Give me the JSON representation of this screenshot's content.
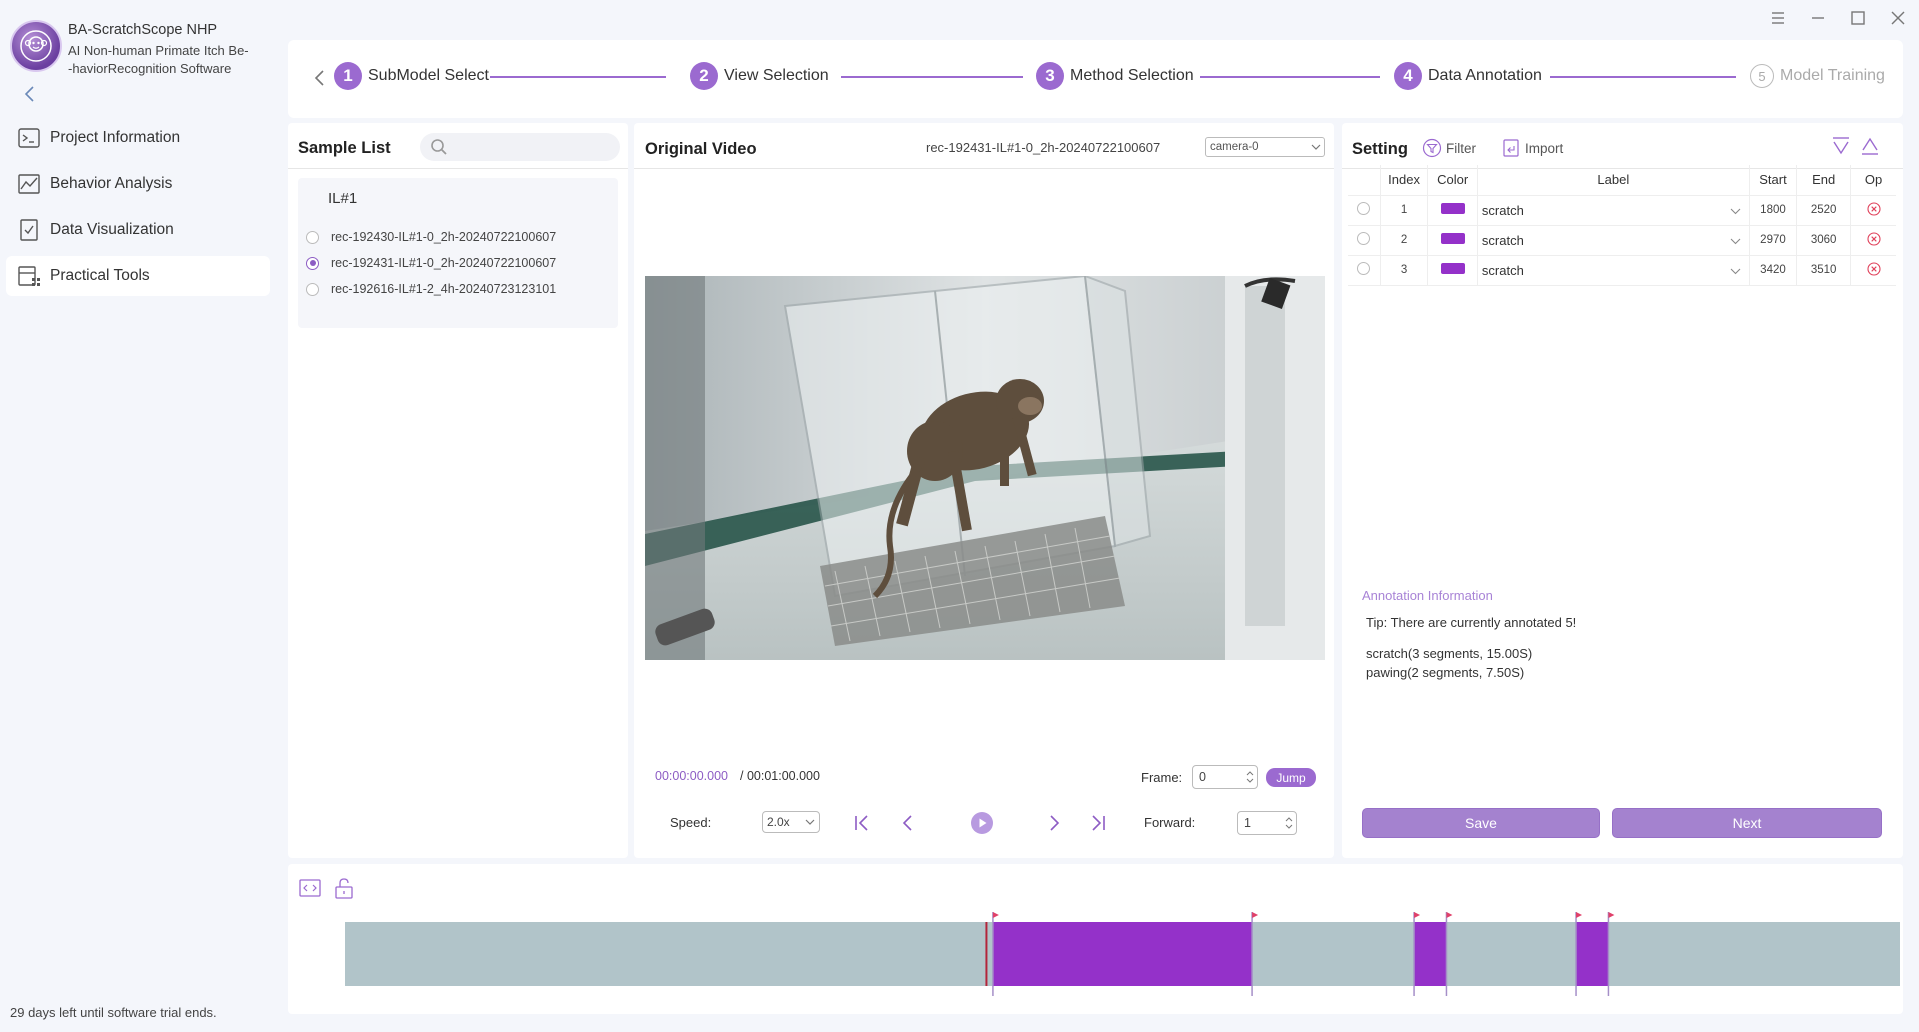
{
  "app": {
    "title": "BA-ScratchScope NHP",
    "subtitle_line1": "AI Non-human Primate Itch Be-",
    "subtitle_line2": "-haviorRecognition Software",
    "trial_notice": "29 days left until software trial ends."
  },
  "nav": {
    "items": [
      {
        "label": "Project Information",
        "icon": "terminal-icon"
      },
      {
        "label": "Behavior Analysis",
        "icon": "chart-icon"
      },
      {
        "label": "Data Visualization",
        "icon": "check-doc-icon"
      },
      {
        "label": "Practical Tools",
        "icon": "tools-icon"
      }
    ],
    "active": "Practical Tools"
  },
  "steps": [
    {
      "num": "1",
      "label": "SubModel Select"
    },
    {
      "num": "2",
      "label": "View Selection"
    },
    {
      "num": "3",
      "label": "Method Selection"
    },
    {
      "num": "4",
      "label": "Data Annotation"
    },
    {
      "num": "5",
      "label": "Model Training"
    }
  ],
  "sample_list": {
    "title": "Sample List",
    "search_placeholder": "",
    "group": "IL#1",
    "items": [
      "rec-192430-IL#1-0_2h-20240722100607",
      "rec-192431-IL#1-0_2h-20240722100607",
      "rec-192616-IL#1-2_4h-20240723123101"
    ],
    "selected_index": 1
  },
  "video": {
    "title": "Original Video",
    "file": "rec-192431-IL#1-0_2h-20240722100607",
    "camera": "camera-0",
    "time_current": "00:00:00.000",
    "time_total": "/ 00:01:00.000",
    "frame_label": "Frame:",
    "frame_value": "0",
    "jump_label": "Jump",
    "speed_label": "Speed:",
    "speed_value": "2.0x",
    "forward_label": "Forward:",
    "forward_value": "1"
  },
  "setting": {
    "title": "Setting",
    "filter_label": "Filter",
    "import_label": "Import",
    "columns": [
      "Index",
      "Color",
      "Label",
      "Start",
      "End",
      "Op"
    ],
    "rows": [
      {
        "index": "1",
        "color": "#9431c9",
        "label": "scratch",
        "start": "1800",
        "end": "2520"
      },
      {
        "index": "2",
        "color": "#9431c9",
        "label": "scratch",
        "start": "2970",
        "end": "3060"
      },
      {
        "index": "3",
        "color": "#9431c9",
        "label": "scratch",
        "start": "3420",
        "end": "3510"
      }
    ],
    "info_title": "Annotation Information",
    "tip": "Tip: There are currently annotated 5!",
    "stats": [
      "scratch(3 segments, 15.00S)",
      "pawing(2 segments, 7.50S)"
    ],
    "save_label": "Save",
    "next_label": "Next"
  },
  "timeline": {
    "total_frames": 7200,
    "playhead_frame": 2970,
    "segments": [
      {
        "start": 3000,
        "end": 4200
      },
      {
        "start": 4950,
        "end": 5100
      },
      {
        "start": 5700,
        "end": 5850
      }
    ],
    "colors": {
      "track": "#b1c4c9",
      "segment": "#9431c9",
      "playhead": "#b3243a",
      "marker": "#e0406a"
    }
  },
  "colors": {
    "accent": "#9b6ad0",
    "active_nav_bg": "#ffffff"
  }
}
